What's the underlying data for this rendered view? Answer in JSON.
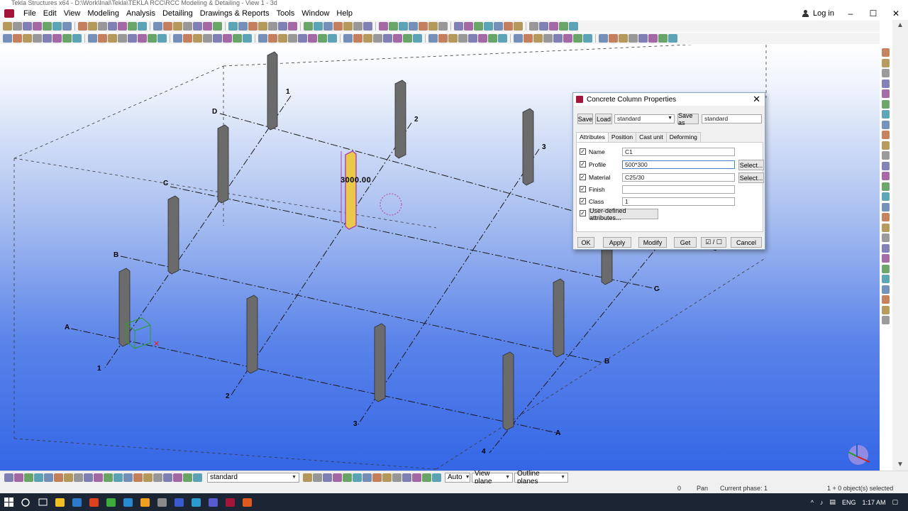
{
  "window": {
    "title": "Tekla Structures x64 - D:\\Work\\Inal\\Tekla\\TEKLA RCC\\RCC Modeling & Detailing - View 1 - 3d",
    "login_label": "Log in",
    "controls": [
      "–",
      "☐",
      "✕"
    ]
  },
  "menu": [
    "File",
    "Edit",
    "View",
    "Modeling",
    "Analysis",
    "Detailing",
    "Drawings & Reports",
    "Tools",
    "Window",
    "Help"
  ],
  "viewport": {
    "grid_labels": {
      "letters": [
        "D",
        "C",
        "B",
        "A",
        "C",
        "B",
        "A"
      ],
      "numbers": [
        "1",
        "2",
        "3",
        "1",
        "2",
        "3",
        "4"
      ]
    },
    "dimension_label": "3000.00"
  },
  "dialog": {
    "title": "Concrete Column Properties",
    "save": "Save",
    "load": "Load",
    "load_value": "standard",
    "save_as": "Save as",
    "save_as_value": "standard",
    "tabs": [
      "Attributes",
      "Position",
      "Cast unit",
      "Deforming"
    ],
    "fields": {
      "name": {
        "label": "Name",
        "value": "C1",
        "checked": true
      },
      "profile": {
        "label": "Profile",
        "value": "500*300",
        "checked": true,
        "select": "Select..."
      },
      "material": {
        "label": "Material",
        "value": "C25/30",
        "checked": true,
        "select": "Select..."
      },
      "finish": {
        "label": "Finish",
        "value": "",
        "checked": true
      },
      "class": {
        "label": "Class",
        "value": "1",
        "checked": true
      }
    },
    "user_defined": "User-defined attributes...",
    "buttons": {
      "ok": "OK",
      "apply": "Apply",
      "modify": "Modify",
      "get": "Get",
      "toggle": "☑ / ☐",
      "cancel": "Cancel"
    }
  },
  "bottom_toolbar": {
    "standard": "standard",
    "auto": "Auto",
    "view_plane": "View plane",
    "outline_planes": "Outline planes"
  },
  "status": {
    "zero": "0",
    "mode": "Pan",
    "phase": "Current phase: 1",
    "selection": "1 + 0 object(s) selected"
  },
  "taskbar": {
    "language": "ENG",
    "time": "1:17 AM"
  },
  "colors": {
    "accent": "#a3163a",
    "viewport_top": "#ffffff",
    "viewport_bottom": "#3466e6",
    "column": "#6c6c6c",
    "selected_column": "#e8c94a"
  }
}
